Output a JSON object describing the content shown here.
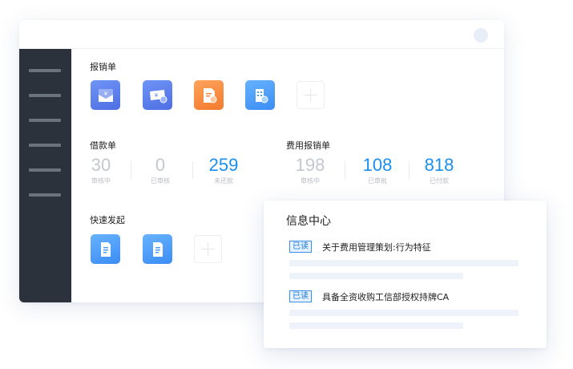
{
  "window": {
    "sidebar_menu_count": 6
  },
  "sections": {
    "reimburse": {
      "title": "报销单",
      "apps": [
        {
          "icon": "envelope-yen-icon",
          "color": "#5b7ef0"
        },
        {
          "icon": "ticket-yen-icon",
          "color": "#5b7ef0"
        },
        {
          "icon": "document-yen-icon",
          "color": "#f58a3c"
        },
        {
          "icon": "building-yen-icon",
          "color": "#4a9cf7"
        }
      ]
    },
    "loan": {
      "title": "借款单",
      "stats": [
        {
          "value": "30",
          "label": "审核中",
          "color": "#c4c8ce"
        },
        {
          "value": "0",
          "label": "已审核",
          "color": "#c4c8ce"
        },
        {
          "value": "259",
          "label": "未还款",
          "color": "#1a8ff0"
        }
      ]
    },
    "expense": {
      "title": "费用报销单",
      "stats": [
        {
          "value": "198",
          "label": "审核中",
          "color": "#c4c8ce"
        },
        {
          "value": "108",
          "label": "已审批",
          "color": "#1a8ff0"
        },
        {
          "value": "818",
          "label": "已付款",
          "color": "#1a8ff0"
        }
      ]
    },
    "quick": {
      "title": "快速发起",
      "apps": [
        {
          "icon": "document-icon",
          "color": "#4a9cf7"
        },
        {
          "icon": "document-icon",
          "color": "#4a9cf7"
        }
      ]
    }
  },
  "message_center": {
    "title": "信息中心",
    "messages": [
      {
        "tag": "已读",
        "text": "关于费用管理策划:行为特征"
      },
      {
        "tag": "已读",
        "text": "具备全资收购工信部授权持牌CA"
      }
    ]
  },
  "colors": {
    "accent": "#1a8ff0",
    "sidebar": "#2b323c",
    "tag_border": "#3a8ee6"
  }
}
